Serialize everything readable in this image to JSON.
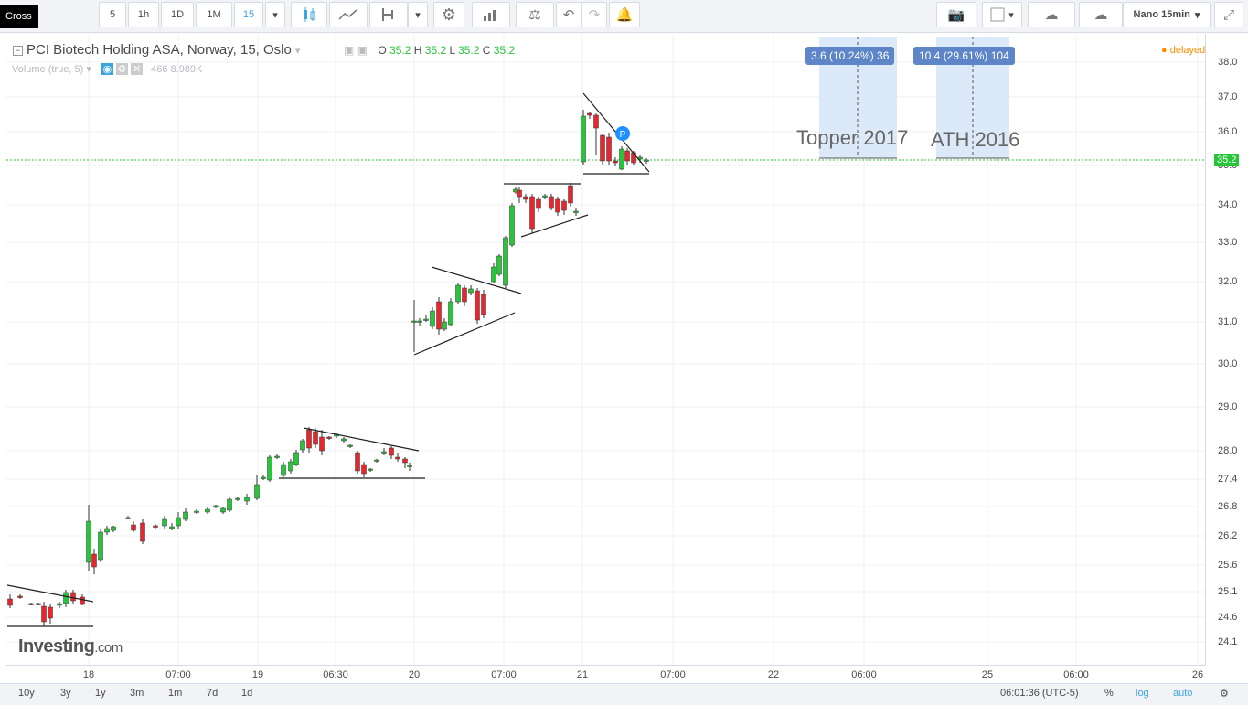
{
  "toolbar": {
    "cursor_label": "Cross",
    "intervals": [
      "5",
      "1h",
      "1D",
      "1M",
      "15"
    ],
    "active_interval": "15",
    "layout_name": "Nano 15min"
  },
  "legend": {
    "title": "PCI Biotech Holding ASA, Norway, 15, Oslo",
    "o_label": "O",
    "o_value": "35.2",
    "h_label": "H",
    "h_value": "35.2",
    "l_label": "L",
    "l_value": "35.2",
    "c_label": "C",
    "c_value": "35.2",
    "volume_label": "Volume (true, 5)",
    "volume_values": "466  8.989K",
    "status": "delayed"
  },
  "price_axis": {
    "ticks": [
      "38.0",
      "37.0",
      "36.0",
      "35.0",
      "34.0",
      "33.0",
      "32.0",
      "31.0",
      "30.0",
      "29.0",
      "28.0",
      "27.4",
      "26.8",
      "26.2",
      "25.6",
      "25.1",
      "24.6",
      "24.1"
    ],
    "last_price": "35.2"
  },
  "time_axis": {
    "ticks": [
      "18",
      "07:00",
      "19",
      "06:30",
      "20",
      "07:00",
      "21",
      "07:00",
      "22",
      "06:00",
      "25",
      "06:00",
      "26"
    ]
  },
  "annotations": {
    "measure1": "3.6 (10.24%) 36",
    "measure2": "10.4 (29.61%) 104",
    "label1": "Topper 2017",
    "label2": "ATH 2016",
    "marker": "P"
  },
  "branding": {
    "logo_main": "Investing",
    "logo_suffix": ".com"
  },
  "bottom_bar": {
    "ranges": [
      "10y",
      "3y",
      "1y",
      "3m",
      "1m",
      "7d",
      "1d"
    ],
    "clock": "06:01:36 (UTC-5)",
    "percent": "%",
    "log": "log",
    "auto": "auto"
  },
  "colors": {
    "up": "#27c63a",
    "down": "#e8262f",
    "accent": "#3ca5e0",
    "measure_bg": "#5d85c7",
    "range_fill": "#dbe9f8"
  }
}
